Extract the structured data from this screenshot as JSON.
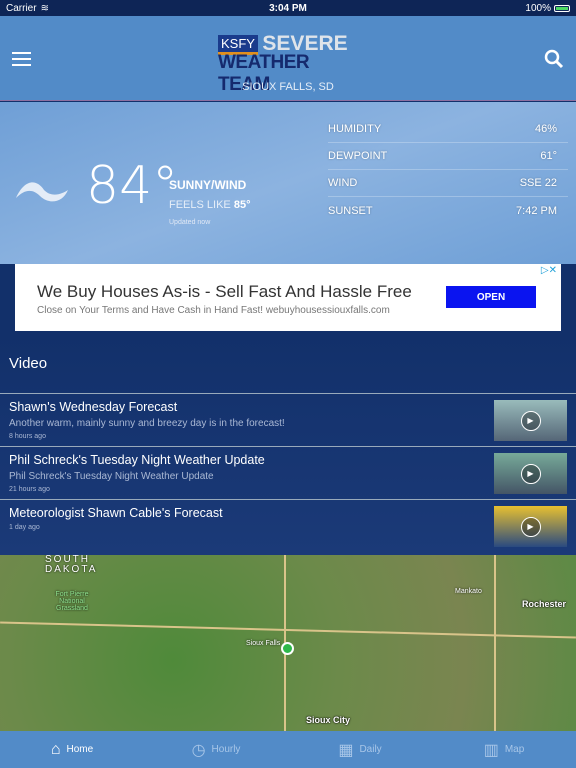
{
  "status": {
    "carrier": "Carrier",
    "time": "3:04 PM",
    "battery": "100%",
    "battery_level": 1.0
  },
  "header": {
    "logo_ksfy": "KSFY",
    "logo_severe": "SEVERE",
    "logo_team": "WEATHER TEAM",
    "city": "SIOUX FALLS, SD"
  },
  "current": {
    "icon": "wind-icon",
    "temperature": "84°",
    "condition": "SUNNY/WIND",
    "feels_label": "FEELS LIKE",
    "feels_value": "85°",
    "updated": "Updated now",
    "stats": [
      {
        "label": "HUMIDITY",
        "value": "46%"
      },
      {
        "label": "DEWPOINT",
        "value": "61°"
      },
      {
        "label": "WIND",
        "value": "SSE 22"
      },
      {
        "label": "SUNSET",
        "value": "7:42 PM"
      }
    ]
  },
  "ad": {
    "title": "We Buy Houses As-is - Sell Fast And Hassle Free",
    "desc": "Close on Your Terms and Have Cash in Hand Fast! webuyhousessiouxfalls.com",
    "button": "OPEN"
  },
  "video": {
    "heading": "Video",
    "items": [
      {
        "title": "Shawn's Wednesday Forecast",
        "desc": "Another warm, mainly sunny and breezy day is in the forecast!",
        "time": "8 hours ago"
      },
      {
        "title": "Phil Schreck's Tuesday Night Weather Update",
        "desc": "Phil Schreck's Tuesday Night Weather Update",
        "time": "21 hours ago"
      },
      {
        "title": "Meteorologist Shawn Cable's Forecast",
        "desc": "",
        "time": "1 day ago"
      }
    ]
  },
  "map": {
    "labels": {
      "state": "SOUTH DAKOTA",
      "park": "Fort Pierre National Grassland",
      "sioux_falls": "Sioux Falls",
      "mankato": "Mankato",
      "rochester": "Rochester",
      "sioux_city": "Sioux City"
    }
  },
  "tabs": [
    {
      "label": "Home",
      "icon": "home-icon"
    },
    {
      "label": "Hourly",
      "icon": "clock-icon"
    },
    {
      "label": "Daily",
      "icon": "calendar-icon"
    },
    {
      "label": "Map",
      "icon": "map-icon"
    }
  ],
  "colors": {
    "header": "#528bc8",
    "status": "#0e2556",
    "video_bg": "#12306a",
    "ad_button": "#0a14f0",
    "pin": "#2eb84a"
  }
}
